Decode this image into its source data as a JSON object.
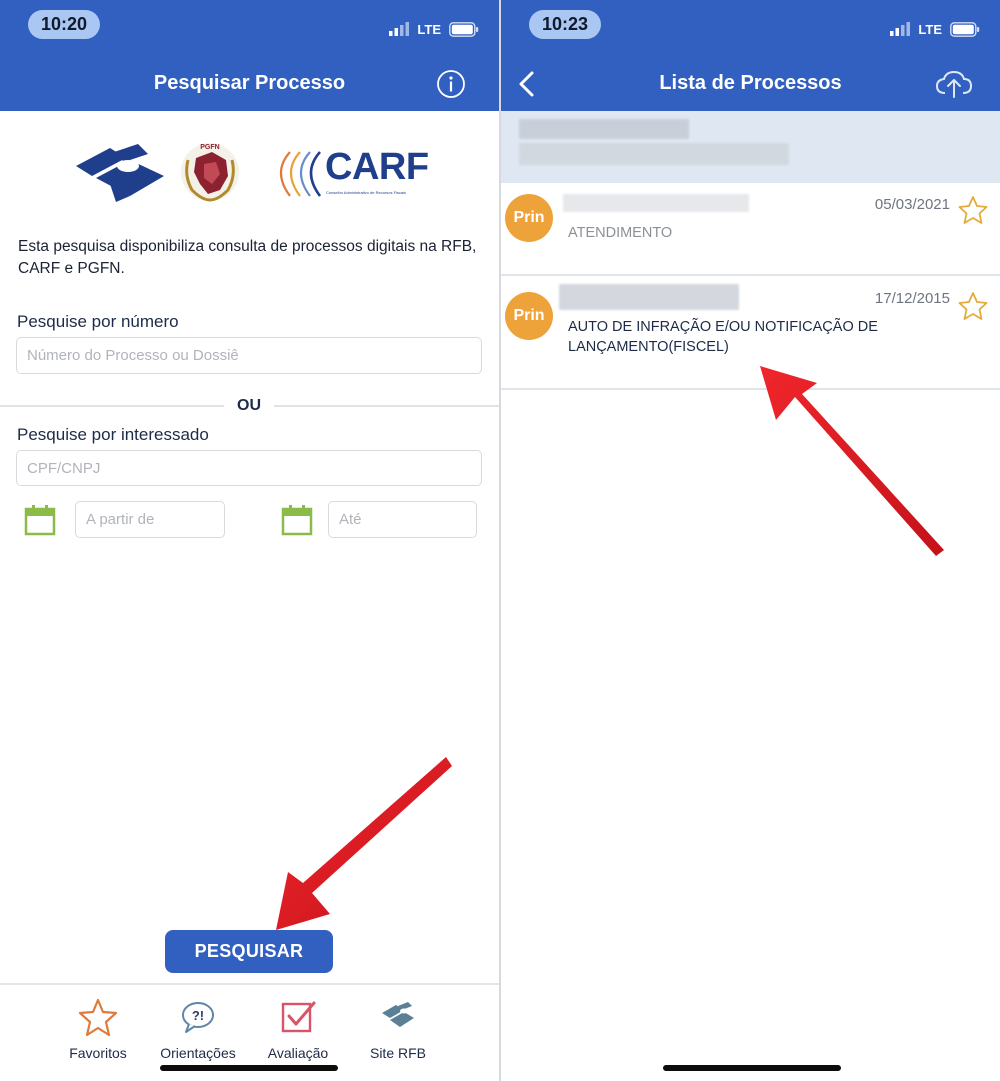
{
  "left": {
    "status": {
      "time": "10:20",
      "network": "LTE"
    },
    "header": {
      "title": "Pesquisar Processo",
      "info_icon": "info-icon"
    },
    "logos": {
      "carf": "CARF",
      "carf_sub": "Conselho Administrativo de Recursos Fiscais",
      "pgfn": "PGFN"
    },
    "intro_text": "Esta pesquisa disponibiliza consulta de processos digitais na RFB, CARF e PGFN.",
    "search_by_number": {
      "label": "Pesquise por número",
      "placeholder": "Número do Processo ou Dossiê"
    },
    "or_text": "OU",
    "search_by_party": {
      "label": "Pesquise por interessado",
      "placeholder": "CPF/CNPJ",
      "from_placeholder": "A partir de",
      "to_placeholder": "Até"
    },
    "search_button": "PESQUISAR",
    "tabs": [
      {
        "label": "Favoritos",
        "icon": "star-icon"
      },
      {
        "label": "Orientações",
        "icon": "help-bubble-icon"
      },
      {
        "label": "Avaliação",
        "icon": "checkbox-icon"
      },
      {
        "label": "Site RFB",
        "icon": "rfb-logo-icon"
      }
    ]
  },
  "right": {
    "status": {
      "time": "10:23",
      "network": "LTE"
    },
    "header": {
      "title": "Lista de Processos",
      "back_icon": "chevron-left-icon",
      "upload_icon": "cloud-upload-icon"
    },
    "results": [
      {
        "badge": "Prin",
        "date": "05/03/2021",
        "description": "ATENDIMENTO"
      },
      {
        "badge": "Prin",
        "date": "17/12/2015",
        "description": "AUTO DE INFRAÇÃO E/OU NOTIFICAÇÃO DE LANÇAMENTO(FISCEL)"
      }
    ]
  },
  "colors": {
    "header_blue": "#3260c1",
    "badge_orange": "#eea23a",
    "star_gold": "#e6a93b",
    "calendar_green": "#8dbb4a",
    "arrow_red": "#e01b22"
  }
}
